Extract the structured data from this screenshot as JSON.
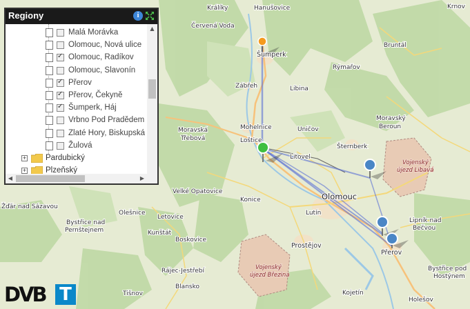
{
  "panel": {
    "title": "Regiony",
    "info_label": "i",
    "items": [
      {
        "label": "Malá Morávka",
        "checked": false
      },
      {
        "label": "Olomouc, Nová ulice",
        "checked": false
      },
      {
        "label": "Olomouc, Radíkov",
        "checked": true
      },
      {
        "label": "Olomouc, Slavonín",
        "checked": false
      },
      {
        "label": "Přerov",
        "checked": true
      },
      {
        "label": "Přerov, Čekyně",
        "checked": true
      },
      {
        "label": "Šumperk, Háj",
        "checked": true
      },
      {
        "label": "Vrbno Pod Pradědem",
        "checked": false
      },
      {
        "label": "Zlaté Hory, Biskupská",
        "checked": false
      },
      {
        "label": "Žulová",
        "checked": false
      }
    ],
    "groups": [
      {
        "label": "Pardubický"
      },
      {
        "label": "Plzeňský"
      }
    ]
  },
  "map": {
    "places": [
      "Králíky",
      "Hanušovice",
      "Červená Voda",
      "Šumperk",
      "Bruntál",
      "Rýmařov",
      "Zábřeh",
      "Libina",
      "Moravský Beroun",
      "Moravská Třebová",
      "Mohelnice",
      "Uničov",
      "Šternberk",
      "Loštice",
      "Litovel",
      "Velké Opatovice",
      "Konice",
      "Olomouc",
      "Lipník nad Bečvou",
      "Olešnice",
      "Letovice",
      "Lutín",
      "Bystřice nad Pernštejnem",
      "Kunštát",
      "Boskovice",
      "Prostějov",
      "Přerov",
      "Rájec-Jestřebí",
      "Blansko",
      "Tišnov",
      "Bystřice pod Hostýnem",
      "Kojetín",
      "Holešov",
      "Krnov",
      "Žďár nad Sázavou"
    ],
    "military_areas": [
      "Vojenský újezd Libavá",
      "Vojenský újezd Březina"
    ]
  },
  "logo": {
    "text": "DVB",
    "t": "T"
  }
}
